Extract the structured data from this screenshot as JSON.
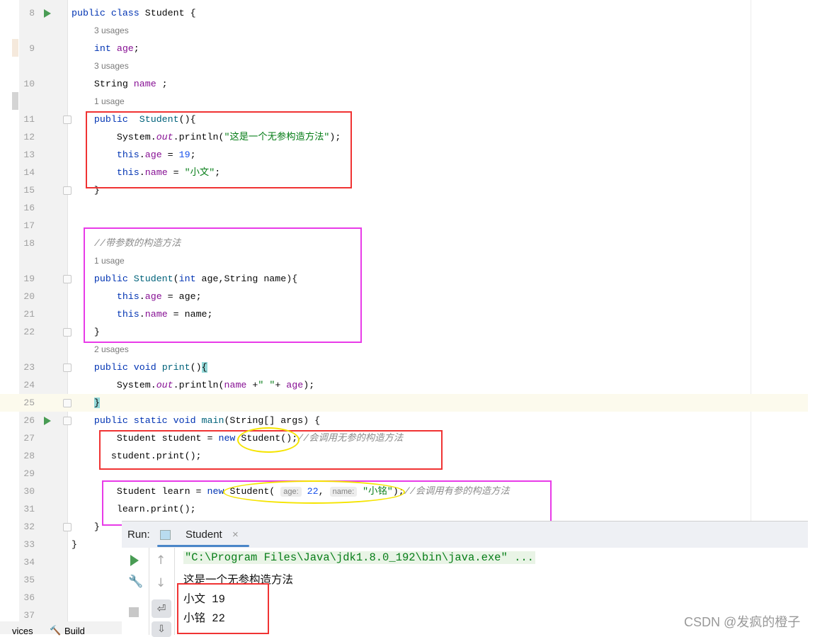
{
  "colors": {
    "red_box": "#f03333",
    "pink_box": "#e83be8",
    "yellow_ellipse": "#f5e400",
    "run_green": "#499c54"
  },
  "rows": [
    {
      "ln": "8",
      "run": true,
      "tokens": [
        [
          "public class ",
          "kw"
        ],
        [
          "Student {",
          ""
        ]
      ]
    },
    {
      "usage": "3 usages"
    },
    {
      "ln": "9",
      "tokens": [
        [
          "    ",
          ""
        ],
        [
          "int ",
          "kw"
        ],
        [
          "age",
          "fld"
        ],
        [
          ";",
          ""
        ]
      ]
    },
    {
      "usage": "3 usages"
    },
    {
      "ln": "10",
      "tokens": [
        [
          "    String ",
          ""
        ],
        [
          "name",
          "fld"
        ],
        [
          " ;",
          ""
        ]
      ]
    },
    {
      "usage": "1 usage"
    },
    {
      "ln": "11",
      "fold": true,
      "tokens": [
        [
          "    ",
          ""
        ],
        [
          "public  ",
          "kw"
        ],
        [
          "Student",
          "fn"
        ],
        [
          "(){",
          ""
        ]
      ]
    },
    {
      "ln": "12",
      "tokens": [
        [
          "        System.",
          ""
        ],
        [
          "out",
          "it"
        ],
        [
          ".println(",
          ""
        ],
        [
          "\"这是一个无参构造方法\"",
          "str"
        ],
        [
          ");",
          ""
        ]
      ]
    },
    {
      "ln": "13",
      "tokens": [
        [
          "        ",
          ""
        ],
        [
          "this",
          "kw"
        ],
        [
          ".",
          ""
        ],
        [
          "age",
          "fld"
        ],
        [
          " = ",
          ""
        ],
        [
          "19",
          "num"
        ],
        [
          ";",
          ""
        ]
      ]
    },
    {
      "ln": "14",
      "tokens": [
        [
          "        ",
          ""
        ],
        [
          "this",
          "kw"
        ],
        [
          ".",
          ""
        ],
        [
          "name",
          "fld"
        ],
        [
          " = ",
          ""
        ],
        [
          "\"小文\"",
          "str"
        ],
        [
          ";",
          ""
        ]
      ]
    },
    {
      "ln": "15",
      "fold": true,
      "tokens": [
        [
          "    }",
          ""
        ]
      ]
    },
    {
      "ln": "16",
      "tokens": []
    },
    {
      "ln": "17",
      "tokens": []
    },
    {
      "ln": "18",
      "tokens": [
        [
          "    ",
          ""
        ],
        [
          "//带参数的构造方法",
          "cm"
        ]
      ]
    },
    {
      "usage": "1 usage"
    },
    {
      "ln": "19",
      "fold": true,
      "tokens": [
        [
          "    ",
          ""
        ],
        [
          "public ",
          "kw"
        ],
        [
          "Student",
          "fn"
        ],
        [
          "(",
          ""
        ],
        [
          "int ",
          "kw"
        ],
        [
          "age,String name){",
          ""
        ]
      ]
    },
    {
      "ln": "20",
      "tokens": [
        [
          "        ",
          ""
        ],
        [
          "this",
          "kw"
        ],
        [
          ".",
          ""
        ],
        [
          "age",
          "fld"
        ],
        [
          " = age;",
          ""
        ]
      ]
    },
    {
      "ln": "21",
      "tokens": [
        [
          "        ",
          ""
        ],
        [
          "this",
          "kw"
        ],
        [
          ".",
          ""
        ],
        [
          "name",
          "fld"
        ],
        [
          " = name;",
          ""
        ]
      ]
    },
    {
      "ln": "22",
      "fold": true,
      "tokens": [
        [
          "    }",
          ""
        ]
      ]
    },
    {
      "usage": "2 usages"
    },
    {
      "ln": "23",
      "fold": true,
      "tokens": [
        [
          "    ",
          ""
        ],
        [
          "public void ",
          "kw"
        ],
        [
          "print",
          "fn"
        ],
        [
          "()",
          ""
        ],
        [
          "{",
          "brace"
        ]
      ]
    },
    {
      "ln": "24",
      "tokens": [
        [
          "        System.",
          ""
        ],
        [
          "out",
          "it"
        ],
        [
          ".println(",
          ""
        ],
        [
          "name",
          "fld"
        ],
        [
          " +",
          ""
        ],
        [
          "\" \"",
          "str"
        ],
        [
          "+ ",
          ""
        ],
        [
          "age",
          "fld"
        ],
        [
          ");",
          ""
        ]
      ]
    },
    {
      "ln": "25",
      "fold": true,
      "hl": true,
      "tokens": [
        [
          "    ",
          ""
        ],
        [
          "}",
          "brace"
        ]
      ]
    },
    {
      "ln": "26",
      "run": true,
      "fold": true,
      "tokens": [
        [
          "    ",
          ""
        ],
        [
          "public static void ",
          "kw"
        ],
        [
          "main",
          "fn"
        ],
        [
          "(String[] args) {",
          ""
        ]
      ]
    },
    {
      "ln": "27",
      "tokens": [
        [
          "        Student student = ",
          ""
        ],
        [
          "new ",
          "kw"
        ],
        [
          "Student();",
          ""
        ],
        [
          "//会调用无参的构造方法",
          "cm"
        ]
      ]
    },
    {
      "ln": "28",
      "tokens": [
        [
          "       student.print();",
          ""
        ]
      ]
    },
    {
      "ln": "29",
      "tokens": []
    },
    {
      "ln": "30",
      "tokens": [
        [
          "        Student learn = ",
          ""
        ],
        [
          "new ",
          "kw"
        ],
        [
          "Student( ",
          ""
        ],
        [
          "age:",
          "hint"
        ],
        [
          " ",
          ""
        ],
        [
          "22",
          "num"
        ],
        [
          ", ",
          ""
        ],
        [
          "name:",
          "hint"
        ],
        [
          " ",
          ""
        ],
        [
          "\"小铭\"",
          "str"
        ],
        [
          ");",
          ""
        ],
        [
          "//会调用有参的构造方法",
          "cm"
        ]
      ]
    },
    {
      "ln": "31",
      "tokens": [
        [
          "        learn.print();",
          ""
        ]
      ]
    },
    {
      "ln": "32",
      "fold": true,
      "tokens": [
        [
          "    }",
          ""
        ]
      ]
    },
    {
      "ln": "33",
      "tokens": [
        [
          "}",
          ""
        ]
      ]
    },
    {
      "ln": "34",
      "tokens": []
    },
    {
      "ln": "35",
      "tokens": []
    },
    {
      "ln": "36",
      "tokens": []
    },
    {
      "ln": "37",
      "tokens": []
    }
  ],
  "run_panel": {
    "label": "Run:",
    "tab": "Student",
    "tab_close": "×",
    "console": [
      "\"C:\\Program Files\\Java\\jdk1.8.0_192\\bin\\java.exe\" ...",
      "这是一个无参构造方法",
      "小文 19",
      "小铭 22"
    ]
  },
  "bottom_bar": {
    "services": "vices",
    "build": "Build"
  },
  "watermark": "CSDN @发疯的橙子"
}
